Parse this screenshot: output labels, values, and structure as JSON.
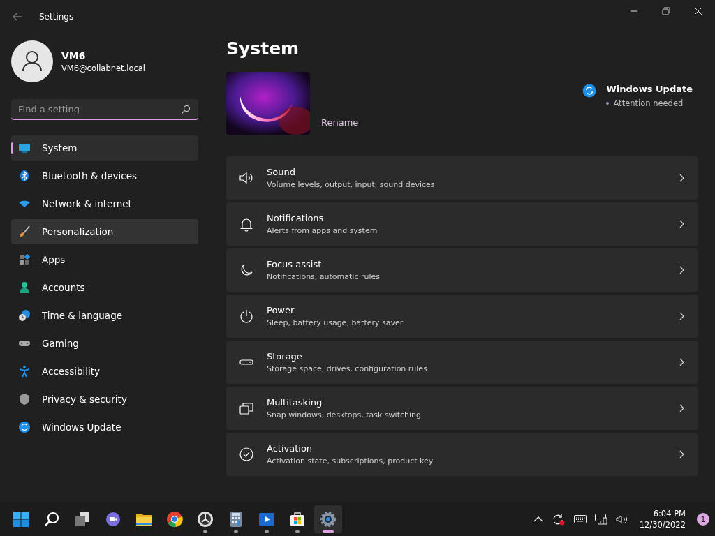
{
  "window": {
    "title": "Settings"
  },
  "user": {
    "name": "VM6",
    "email": "VM6@collabnet.local"
  },
  "search": {
    "placeholder": "Find a setting"
  },
  "sidebar": {
    "items": [
      {
        "label": "System",
        "kind": "system",
        "selected": true,
        "hovered": false
      },
      {
        "label": "Bluetooth & devices",
        "kind": "bluetooth",
        "selected": false,
        "hovered": false
      },
      {
        "label": "Network & internet",
        "kind": "network",
        "selected": false,
        "hovered": false
      },
      {
        "label": "Personalization",
        "kind": "brush",
        "selected": false,
        "hovered": true
      },
      {
        "label": "Apps",
        "kind": "apps",
        "selected": false,
        "hovered": false
      },
      {
        "label": "Accounts",
        "kind": "accounts",
        "selected": false,
        "hovered": false
      },
      {
        "label": "Time & language",
        "kind": "time",
        "selected": false,
        "hovered": false
      },
      {
        "label": "Gaming",
        "kind": "gaming",
        "selected": false,
        "hovered": false
      },
      {
        "label": "Accessibility",
        "kind": "accessibility",
        "selected": false,
        "hovered": false
      },
      {
        "label": "Privacy & security",
        "kind": "shield",
        "selected": false,
        "hovered": false
      },
      {
        "label": "Windows Update",
        "kind": "update",
        "selected": false,
        "hovered": false
      }
    ]
  },
  "page": {
    "title": "System",
    "device": {
      "kind": "picture",
      "action": "Rename"
    },
    "update": {
      "title": "Windows Update",
      "status": "Attention needed"
    }
  },
  "settings": [
    {
      "title": "Sound",
      "subtitle": "Volume levels, output, input, sound devices",
      "kind": "sound"
    },
    {
      "title": "Notifications",
      "subtitle": "Alerts from apps and system",
      "kind": "bell"
    },
    {
      "title": "Focus assist",
      "subtitle": "Notifications, automatic rules",
      "kind": "moon"
    },
    {
      "title": "Power",
      "subtitle": "Sleep, battery usage, battery saver",
      "kind": "power"
    },
    {
      "title": "Storage",
      "subtitle": "Storage space, drives, configuration rules",
      "kind": "storage"
    },
    {
      "title": "Multitasking",
      "subtitle": "Snap windows, desktops, task switching",
      "kind": "multitask"
    },
    {
      "title": "Activation",
      "subtitle": "Activation state, subscriptions, product key",
      "kind": "check"
    }
  ],
  "taskbar": {
    "apps": [
      {
        "kind": "start",
        "running": false,
        "active": false
      },
      {
        "kind": "search",
        "running": false,
        "active": false
      },
      {
        "kind": "taskview",
        "running": false,
        "active": false
      },
      {
        "kind": "chat",
        "running": false,
        "active": false
      },
      {
        "kind": "folder",
        "running": false,
        "active": false
      },
      {
        "kind": "browser",
        "running": false,
        "active": false
      },
      {
        "kind": "clock",
        "running": true,
        "active": false
      },
      {
        "kind": "calculator",
        "running": true,
        "active": false
      },
      {
        "kind": "video",
        "running": true,
        "active": false
      },
      {
        "kind": "store",
        "running": true,
        "active": false
      },
      {
        "kind": "settings",
        "running": true,
        "active": true
      }
    ],
    "time": "6:04 PM",
    "date": "12/30/2022",
    "notifications": "1"
  }
}
